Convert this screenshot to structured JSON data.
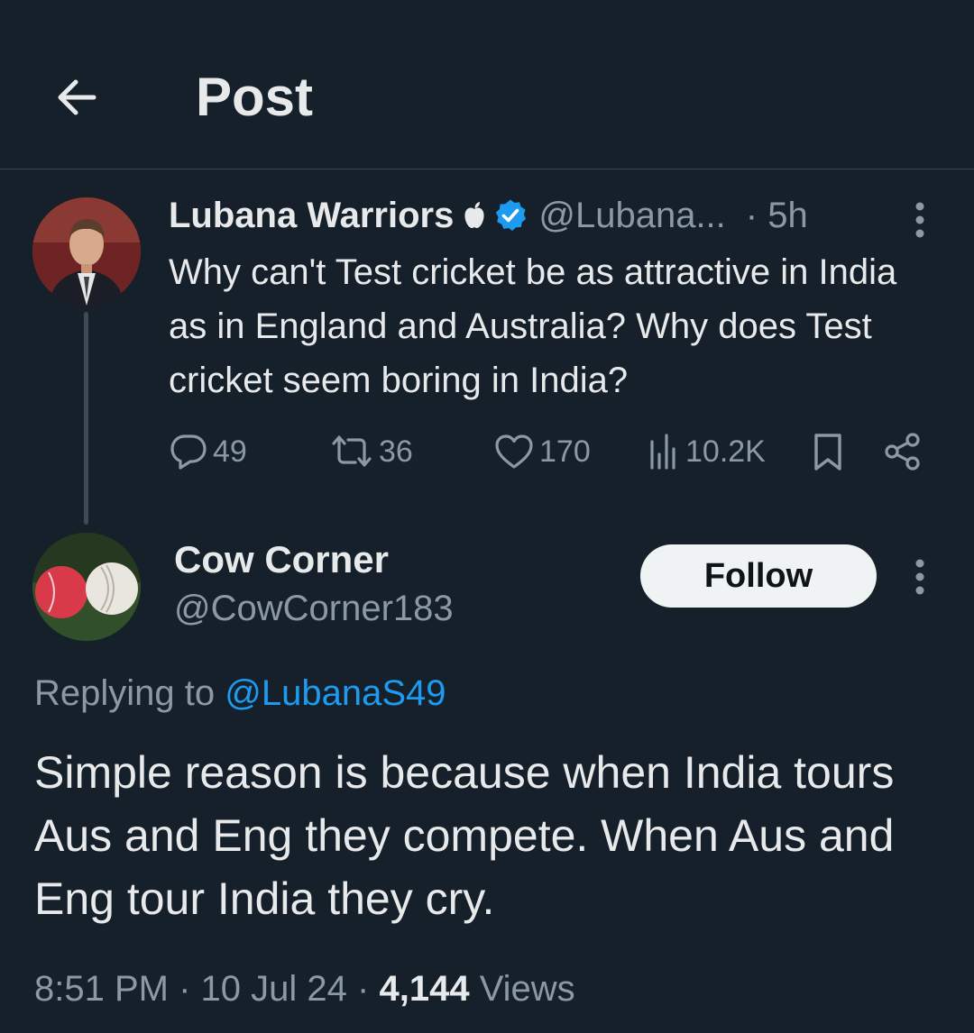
{
  "header": {
    "title": "Post"
  },
  "original_post": {
    "author_name": "Lubana Warriors",
    "author_handle": "@Lubana...",
    "time": "· 5h",
    "text": "Why can't Test cricket be as attractive in India as in England and Australia? Why does Test cricket seem boring in India?",
    "stats": {
      "replies": "49",
      "reposts": "36",
      "likes": "170",
      "views": "10.2K"
    }
  },
  "reply_post": {
    "author_name": "Cow Corner",
    "author_handle": "@CowCorner183",
    "follow_label": "Follow",
    "replying_to_prefix": "Replying to",
    "replying_to_handle": "@LubanaS49",
    "text": "Simple reason is because when India tours Aus and Eng they compete. When Aus and Eng tour India they cry.",
    "time": "8:51 PM",
    "date": "10 Jul 24",
    "separator": "·",
    "views_count": "4,144",
    "views_label": "Views"
  },
  "colors": {
    "background": "#16202a",
    "text_primary": "#e7e9ea",
    "text_secondary": "#8b98a5",
    "accent": "#1d9bf0",
    "divider": "#38444d"
  },
  "icons": [
    "back-arrow-icon",
    "apple-icon",
    "verified-badge-icon",
    "more-icon",
    "reply-icon",
    "repost-icon",
    "like-icon",
    "views-icon",
    "bookmark-icon",
    "share-icon"
  ]
}
